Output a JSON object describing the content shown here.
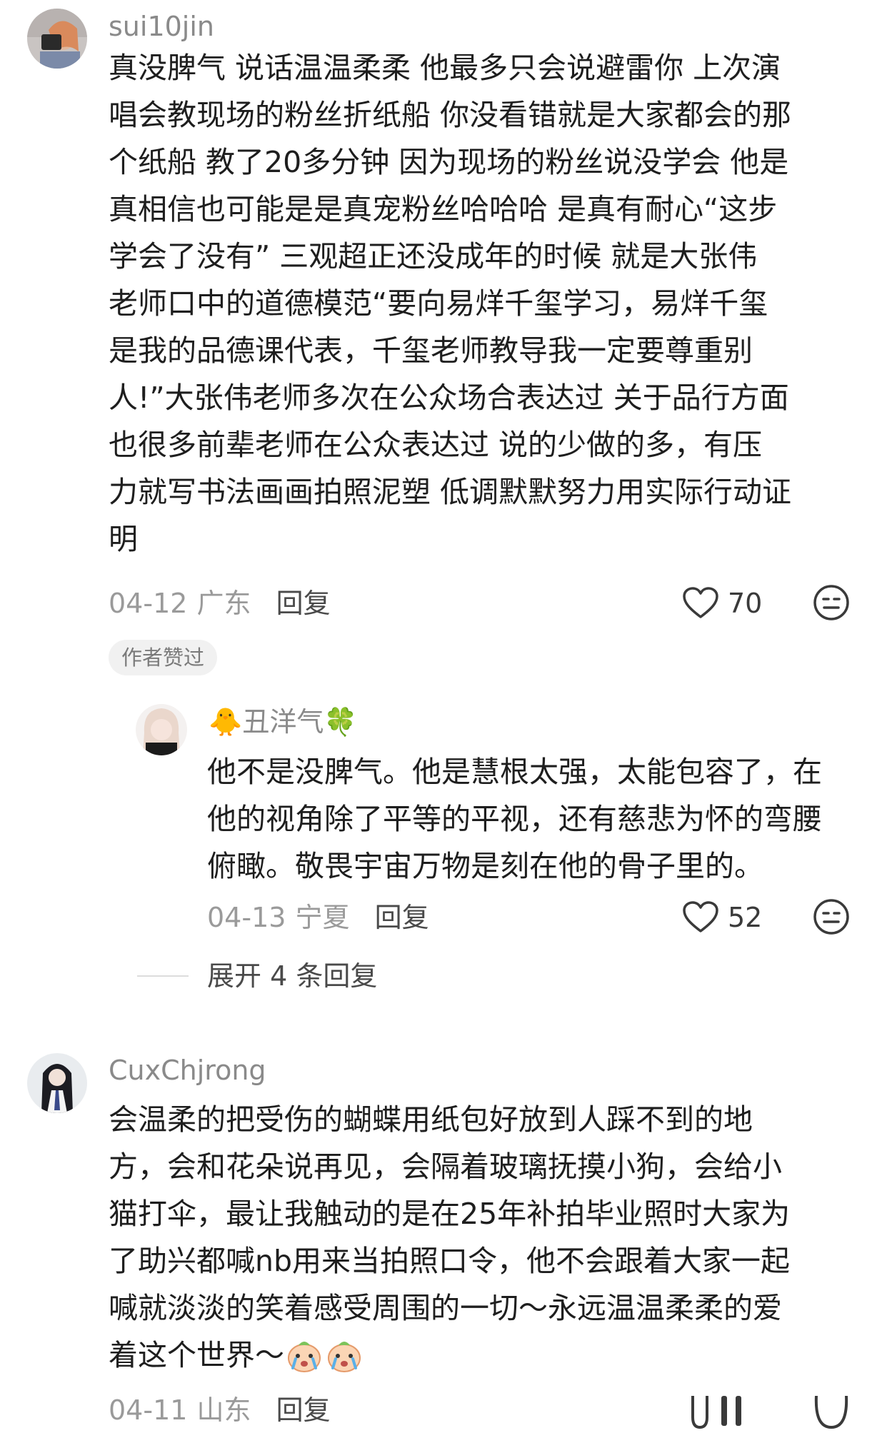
{
  "comments": [
    {
      "username": "sui10jin",
      "lines": [
        "真没脾气 说话温温柔柔 他最多只会说避雷你 上次演",
        "唱会教现场的粉丝折纸船 你没看错就是大家都会的那",
        "个纸船 教了20多分钟 因为现场的粉丝说没学会 他是",
        "真相信也可能是是真宠粉丝哈哈哈 是真有耐心“这步",
        "学会了没有”   三观超正还没成年的时候 就是大张伟",
        "老师口中的道德模范“要向易烊千玺学习，易烊千玺",
        "是我的品德课代表，千玺老师教导我一定要尊重别",
        "人!”大张伟老师多次在公众场合表达过 关于品行方面",
        "也很多前辈老师在公众表达过   说的少做的多，有压",
        "力就写书法画画拍照泥塑 低调默默努力用实际行动证",
        "明"
      ],
      "date": "04-12",
      "location": "广东",
      "reply_label": "回复",
      "likes": "70",
      "badge": "作者赞过",
      "sub_reply": {
        "username": "🐥丑洋气🍀",
        "lines": [
          "他不是没脾气。他是慧根太强，太能包容了，在",
          "他的视角除了平等的平视，还有慈悲为怀的弯腰",
          "俯瞰。敬畏宇宙万物是刻在他的骨子里的。"
        ],
        "date": "04-13",
        "location": "宁夏",
        "reply_label": "回复",
        "likes": "52"
      },
      "expand_label": "展开 4 条回复"
    },
    {
      "username": "CuxChjrong",
      "lines": [
        "会温柔的把受伤的蝴蝶用纸包好放到人踩不到的地",
        "方，会和花朵说再见，会隔着玻璃抚摸小狗，会给小",
        "猫打伞，最让我触动的是在25年补拍毕业照时大家为",
        "了助兴都喊nb用来当拍照口令，他不会跟着大家一起",
        "喊就淡淡的笑着感受周围的一切～永远温温柔柔的爱",
        "着这个世界～"
      ],
      "date": "04-11",
      "location": "山东",
      "reply_label": "回复"
    }
  ],
  "icons": {
    "like": "heart-outline-icon",
    "dislike": "neutral-face-icon",
    "emoji": "crying-face-sticker-icon"
  }
}
